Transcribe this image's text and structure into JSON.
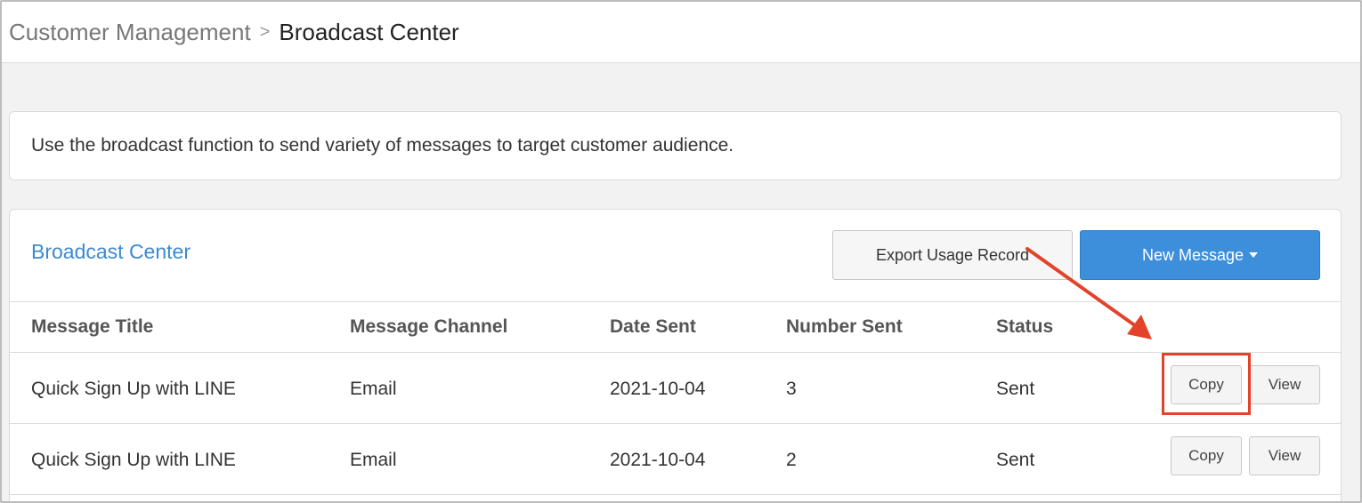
{
  "breadcrumb": {
    "parent": "Customer Management",
    "separator": ">",
    "current": "Broadcast Center"
  },
  "info": {
    "text": "Use the broadcast function to send variety of messages to target customer audience."
  },
  "card": {
    "title": "Broadcast Center",
    "export_label": "Export Usage Record",
    "new_message_label": "New Message"
  },
  "table": {
    "headers": [
      "Message Title",
      "Message Channel",
      "Date Sent",
      "Number Sent",
      "Status"
    ],
    "rows": [
      {
        "title": "Quick Sign Up with LINE",
        "channel": "Email",
        "date": "2021-10-04",
        "number": "3",
        "status": "Sent",
        "copy": "Copy",
        "view": "View"
      },
      {
        "title": "Quick Sign Up with LINE",
        "channel": "Email",
        "date": "2021-10-04",
        "number": "2",
        "status": "Sent",
        "copy": "Copy",
        "view": "View"
      }
    ]
  },
  "colors": {
    "accent": "#3d8fdc",
    "title_blue": "#3a8ad2",
    "annotation_red": "#e2432a"
  }
}
